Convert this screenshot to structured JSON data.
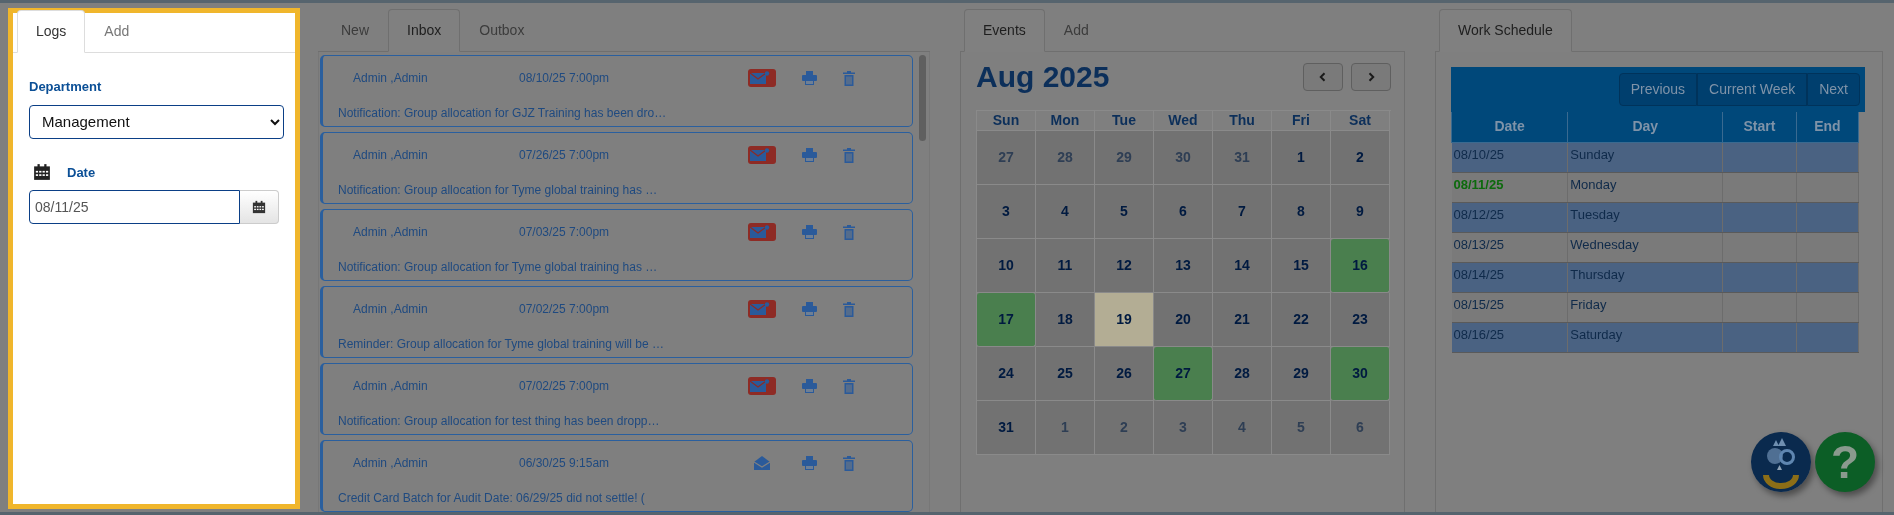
{
  "logs_panel": {
    "tabs": [
      {
        "label": "Logs",
        "selected": true
      },
      {
        "label": "Add",
        "selected": false
      }
    ],
    "department": {
      "label": "Department",
      "value": "Management"
    },
    "date": {
      "label": "Date",
      "value": "08/11/25"
    }
  },
  "messages": {
    "tabs": [
      {
        "label": "New",
        "selected": false
      },
      {
        "label": "Inbox",
        "selected": true
      },
      {
        "label": "Outbox",
        "selected": false
      }
    ],
    "items": [
      {
        "sender": "Admin ,Admin",
        "time": "08/10/25 7:00pm",
        "preview": "Notification: Group allocation for GJZ Training has been dro…",
        "unread": true
      },
      {
        "sender": "Admin ,Admin",
        "time": "07/26/25 7:00pm",
        "preview": "Notification: Group allocation for Tyme global training has …",
        "unread": true
      },
      {
        "sender": "Admin ,Admin",
        "time": "07/03/25 7:00pm",
        "preview": "Notification: Group allocation for Tyme global training has …",
        "unread": true
      },
      {
        "sender": "Admin ,Admin",
        "time": "07/02/25 7:00pm",
        "preview": "Reminder: Group allocation for Tyme global training will be …",
        "unread": true
      },
      {
        "sender": "Admin ,Admin",
        "time": "07/02/25 7:00pm",
        "preview": "Notification: Group allocation for test thing has been dropp…",
        "unread": true
      },
      {
        "sender": "Admin ,Admin",
        "time": "06/30/25 9:15am",
        "preview": "Credit Card Batch for Audit Date: 06/29/25 did not settle! (",
        "unread": false
      }
    ]
  },
  "calendar": {
    "tabs": [
      {
        "label": "Events",
        "selected": true
      },
      {
        "label": "Add",
        "selected": false
      }
    ],
    "title": "Aug 2025",
    "weekdays": [
      "Sun",
      "Mon",
      "Tue",
      "Wed",
      "Thu",
      "Fri",
      "Sat"
    ],
    "weeks": [
      [
        {
          "day": "27",
          "outside": true,
          "event": false,
          "highlighted": false
        },
        {
          "day": "28",
          "outside": true,
          "event": false,
          "highlighted": false
        },
        {
          "day": "29",
          "outside": true,
          "event": false,
          "highlighted": false
        },
        {
          "day": "30",
          "outside": true,
          "event": false,
          "highlighted": false
        },
        {
          "day": "31",
          "outside": true,
          "event": false,
          "highlighted": false
        },
        {
          "day": "1",
          "outside": false,
          "event": false,
          "highlighted": false
        },
        {
          "day": "2",
          "outside": false,
          "event": false,
          "highlighted": false
        }
      ],
      [
        {
          "day": "3",
          "outside": false,
          "event": false,
          "highlighted": false
        },
        {
          "day": "4",
          "outside": false,
          "event": false,
          "highlighted": false
        },
        {
          "day": "5",
          "outside": false,
          "event": false,
          "highlighted": false
        },
        {
          "day": "6",
          "outside": false,
          "event": false,
          "highlighted": false
        },
        {
          "day": "7",
          "outside": false,
          "event": false,
          "highlighted": false
        },
        {
          "day": "8",
          "outside": false,
          "event": false,
          "highlighted": false
        },
        {
          "day": "9",
          "outside": false,
          "event": false,
          "highlighted": false
        }
      ],
      [
        {
          "day": "10",
          "outside": false,
          "event": false,
          "highlighted": false
        },
        {
          "day": "11",
          "outside": false,
          "event": false,
          "highlighted": false
        },
        {
          "day": "12",
          "outside": false,
          "event": false,
          "highlighted": false
        },
        {
          "day": "13",
          "outside": false,
          "event": false,
          "highlighted": false
        },
        {
          "day": "14",
          "outside": false,
          "event": false,
          "highlighted": false
        },
        {
          "day": "15",
          "outside": false,
          "event": false,
          "highlighted": false
        },
        {
          "day": "16",
          "outside": false,
          "event": true,
          "highlighted": false
        }
      ],
      [
        {
          "day": "17",
          "outside": false,
          "event": true,
          "highlighted": false
        },
        {
          "day": "18",
          "outside": false,
          "event": false,
          "highlighted": false
        },
        {
          "day": "19",
          "outside": false,
          "event": false,
          "highlighted": true
        },
        {
          "day": "20",
          "outside": false,
          "event": false,
          "highlighted": false
        },
        {
          "day": "21",
          "outside": false,
          "event": false,
          "highlighted": false
        },
        {
          "day": "22",
          "outside": false,
          "event": false,
          "highlighted": false
        },
        {
          "day": "23",
          "outside": false,
          "event": false,
          "highlighted": false
        }
      ],
      [
        {
          "day": "24",
          "outside": false,
          "event": false,
          "highlighted": false
        },
        {
          "day": "25",
          "outside": false,
          "event": false,
          "highlighted": false
        },
        {
          "day": "26",
          "outside": false,
          "event": false,
          "highlighted": false
        },
        {
          "day": "27",
          "outside": false,
          "event": true,
          "highlighted": false
        },
        {
          "day": "28",
          "outside": false,
          "event": false,
          "highlighted": false
        },
        {
          "day": "29",
          "outside": false,
          "event": false,
          "highlighted": false
        },
        {
          "day": "30",
          "outside": false,
          "event": true,
          "highlighted": false
        }
      ],
      [
        {
          "day": "31",
          "outside": false,
          "event": false,
          "highlighted": false
        },
        {
          "day": "1",
          "outside": true,
          "event": false,
          "highlighted": false
        },
        {
          "day": "2",
          "outside": true,
          "event": false,
          "highlighted": false
        },
        {
          "day": "3",
          "outside": true,
          "event": false,
          "highlighted": false
        },
        {
          "day": "4",
          "outside": true,
          "event": false,
          "highlighted": false
        },
        {
          "day": "5",
          "outside": true,
          "event": false,
          "highlighted": false
        },
        {
          "day": "6",
          "outside": true,
          "event": false,
          "highlighted": false
        }
      ]
    ]
  },
  "schedule": {
    "tabs": [
      {
        "label": "Work Schedule",
        "selected": true
      }
    ],
    "buttons": [
      "Previous",
      "Current Week",
      "Next"
    ],
    "columns": [
      "Date",
      "Day",
      "Start",
      "End"
    ],
    "rows": [
      {
        "date": "08/10/25",
        "day": "Sunday",
        "today": false
      },
      {
        "date": "08/11/25",
        "day": "Monday",
        "today": true
      },
      {
        "date": "08/12/25",
        "day": "Tuesday",
        "today": false
      },
      {
        "date": "08/13/25",
        "day": "Wednesday",
        "today": false
      },
      {
        "date": "08/14/25",
        "day": "Thursday",
        "today": false
      },
      {
        "date": "08/15/25",
        "day": "Friday",
        "today": false
      },
      {
        "date": "08/16/25",
        "day": "Saturday",
        "today": false
      }
    ]
  },
  "help_button": {
    "symbol": "?"
  }
}
